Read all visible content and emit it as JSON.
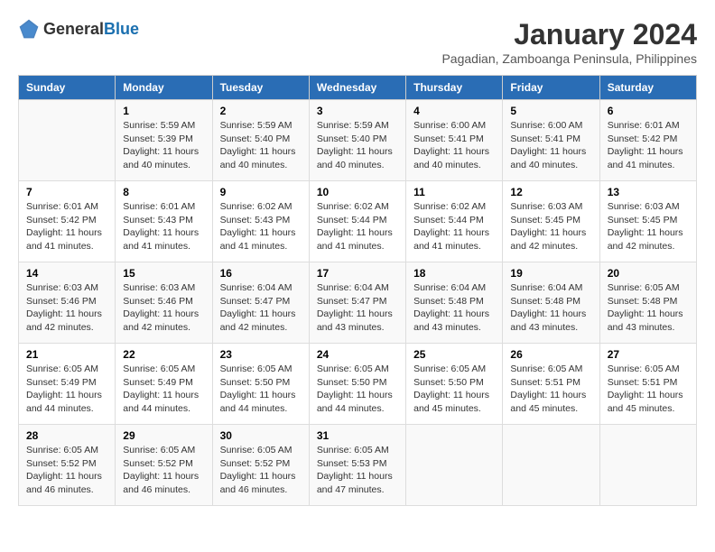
{
  "logo": {
    "general": "General",
    "blue": "Blue"
  },
  "title": "January 2024",
  "subtitle": "Pagadian, Zamboanga Peninsula, Philippines",
  "headers": [
    "Sunday",
    "Monday",
    "Tuesday",
    "Wednesday",
    "Thursday",
    "Friday",
    "Saturday"
  ],
  "weeks": [
    [
      {
        "day": "",
        "info": ""
      },
      {
        "day": "1",
        "info": "Sunrise: 5:59 AM\nSunset: 5:39 PM\nDaylight: 11 hours\nand 40 minutes."
      },
      {
        "day": "2",
        "info": "Sunrise: 5:59 AM\nSunset: 5:40 PM\nDaylight: 11 hours\nand 40 minutes."
      },
      {
        "day": "3",
        "info": "Sunrise: 5:59 AM\nSunset: 5:40 PM\nDaylight: 11 hours\nand 40 minutes."
      },
      {
        "day": "4",
        "info": "Sunrise: 6:00 AM\nSunset: 5:41 PM\nDaylight: 11 hours\nand 40 minutes."
      },
      {
        "day": "5",
        "info": "Sunrise: 6:00 AM\nSunset: 5:41 PM\nDaylight: 11 hours\nand 40 minutes."
      },
      {
        "day": "6",
        "info": "Sunrise: 6:01 AM\nSunset: 5:42 PM\nDaylight: 11 hours\nand 41 minutes."
      }
    ],
    [
      {
        "day": "7",
        "info": "Sunrise: 6:01 AM\nSunset: 5:42 PM\nDaylight: 11 hours\nand 41 minutes."
      },
      {
        "day": "8",
        "info": "Sunrise: 6:01 AM\nSunset: 5:43 PM\nDaylight: 11 hours\nand 41 minutes."
      },
      {
        "day": "9",
        "info": "Sunrise: 6:02 AM\nSunset: 5:43 PM\nDaylight: 11 hours\nand 41 minutes."
      },
      {
        "day": "10",
        "info": "Sunrise: 6:02 AM\nSunset: 5:44 PM\nDaylight: 11 hours\nand 41 minutes."
      },
      {
        "day": "11",
        "info": "Sunrise: 6:02 AM\nSunset: 5:44 PM\nDaylight: 11 hours\nand 41 minutes."
      },
      {
        "day": "12",
        "info": "Sunrise: 6:03 AM\nSunset: 5:45 PM\nDaylight: 11 hours\nand 42 minutes."
      },
      {
        "day": "13",
        "info": "Sunrise: 6:03 AM\nSunset: 5:45 PM\nDaylight: 11 hours\nand 42 minutes."
      }
    ],
    [
      {
        "day": "14",
        "info": "Sunrise: 6:03 AM\nSunset: 5:46 PM\nDaylight: 11 hours\nand 42 minutes."
      },
      {
        "day": "15",
        "info": "Sunrise: 6:03 AM\nSunset: 5:46 PM\nDaylight: 11 hours\nand 42 minutes."
      },
      {
        "day": "16",
        "info": "Sunrise: 6:04 AM\nSunset: 5:47 PM\nDaylight: 11 hours\nand 42 minutes."
      },
      {
        "day": "17",
        "info": "Sunrise: 6:04 AM\nSunset: 5:47 PM\nDaylight: 11 hours\nand 43 minutes."
      },
      {
        "day": "18",
        "info": "Sunrise: 6:04 AM\nSunset: 5:48 PM\nDaylight: 11 hours\nand 43 minutes."
      },
      {
        "day": "19",
        "info": "Sunrise: 6:04 AM\nSunset: 5:48 PM\nDaylight: 11 hours\nand 43 minutes."
      },
      {
        "day": "20",
        "info": "Sunrise: 6:05 AM\nSunset: 5:48 PM\nDaylight: 11 hours\nand 43 minutes."
      }
    ],
    [
      {
        "day": "21",
        "info": "Sunrise: 6:05 AM\nSunset: 5:49 PM\nDaylight: 11 hours\nand 44 minutes."
      },
      {
        "day": "22",
        "info": "Sunrise: 6:05 AM\nSunset: 5:49 PM\nDaylight: 11 hours\nand 44 minutes."
      },
      {
        "day": "23",
        "info": "Sunrise: 6:05 AM\nSunset: 5:50 PM\nDaylight: 11 hours\nand 44 minutes."
      },
      {
        "day": "24",
        "info": "Sunrise: 6:05 AM\nSunset: 5:50 PM\nDaylight: 11 hours\nand 44 minutes."
      },
      {
        "day": "25",
        "info": "Sunrise: 6:05 AM\nSunset: 5:50 PM\nDaylight: 11 hours\nand 45 minutes."
      },
      {
        "day": "26",
        "info": "Sunrise: 6:05 AM\nSunset: 5:51 PM\nDaylight: 11 hours\nand 45 minutes."
      },
      {
        "day": "27",
        "info": "Sunrise: 6:05 AM\nSunset: 5:51 PM\nDaylight: 11 hours\nand 45 minutes."
      }
    ],
    [
      {
        "day": "28",
        "info": "Sunrise: 6:05 AM\nSunset: 5:52 PM\nDaylight: 11 hours\nand 46 minutes."
      },
      {
        "day": "29",
        "info": "Sunrise: 6:05 AM\nSunset: 5:52 PM\nDaylight: 11 hours\nand 46 minutes."
      },
      {
        "day": "30",
        "info": "Sunrise: 6:05 AM\nSunset: 5:52 PM\nDaylight: 11 hours\nand 46 minutes."
      },
      {
        "day": "31",
        "info": "Sunrise: 6:05 AM\nSunset: 5:53 PM\nDaylight: 11 hours\nand 47 minutes."
      },
      {
        "day": "",
        "info": ""
      },
      {
        "day": "",
        "info": ""
      },
      {
        "day": "",
        "info": ""
      }
    ]
  ]
}
